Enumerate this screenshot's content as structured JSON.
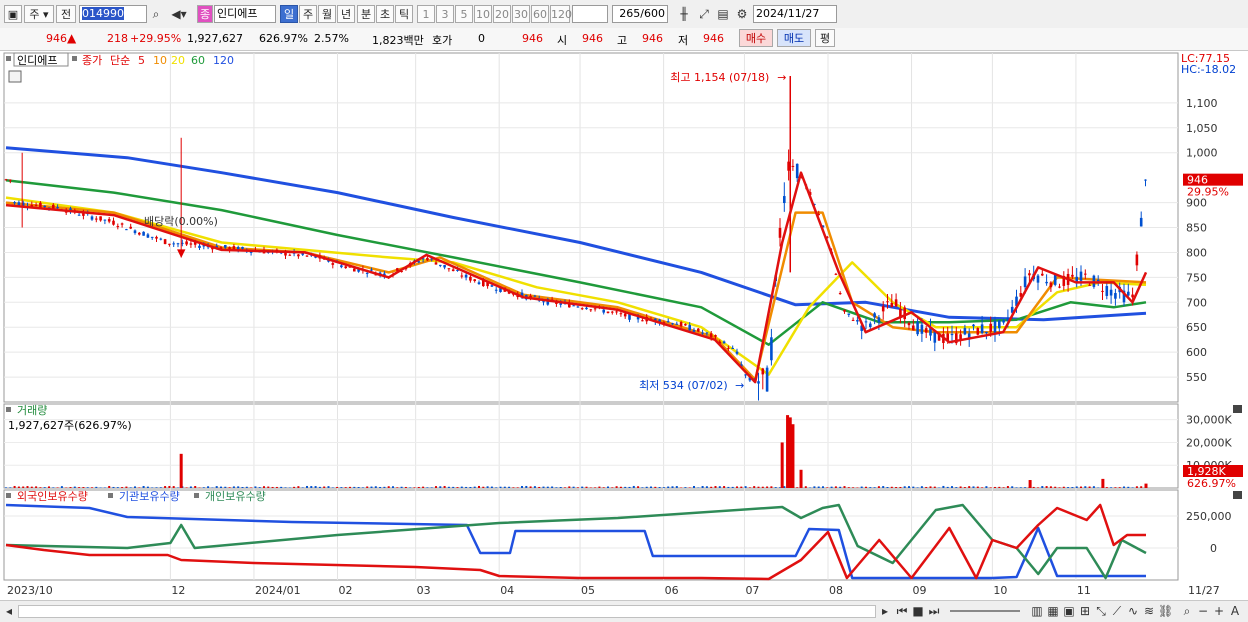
{
  "toolbar": {
    "type_label": "주",
    "market_label": "전",
    "code": "014990",
    "name_badge": "종",
    "name": "인디에프",
    "periods": [
      "일",
      "주",
      "월",
      "년",
      "분",
      "초",
      "틱"
    ],
    "period_selected": "일",
    "intervals": [
      "1",
      "3",
      "5",
      "10",
      "20",
      "30",
      "60",
      "120"
    ],
    "count": "265",
    "count_total": "/600",
    "date": "2024/11/27"
  },
  "quote": {
    "price": "946",
    "price_arrow": "▲",
    "change": "218",
    "change_pct": "+29.95%",
    "volume": "1,927,627",
    "volume_pct": "626.97%",
    "turnover": "2.57%",
    "amount": "1,823백만",
    "hoga_label": "호가",
    "hoga_value": "0",
    "hoga_price": "946",
    "open_label": "시",
    "open": "946",
    "high_label": "고",
    "high": "946",
    "low_label": "저",
    "low": "946",
    "buy_label": "매수",
    "sell_label": "매도",
    "avg_label": "평"
  },
  "colors": {
    "up": "#e00000",
    "down": "#0050d0",
    "ma5": "#e01010",
    "ma10": "#f08c00",
    "ma20": "#f0e000",
    "ma60": "#1f9a3a",
    "ma120": "#2050e0",
    "foreign": "#e01010",
    "institution": "#2050e0",
    "individual": "#2e8b57"
  },
  "chart_data": [
    {
      "type": "candlestick",
      "legend": {
        "name": "인디에프",
        "price_label": "종가",
        "ma_label": "단순",
        "ma_periods": [
          "5",
          "10",
          "20",
          "60",
          "120"
        ]
      },
      "ylim": [
        500,
        1180
      ],
      "yticks": [
        "550",
        "600",
        "650",
        "700",
        "750",
        "800",
        "850",
        "900",
        "1,000",
        "1,050",
        "1,100"
      ],
      "lc_label": "LC:77.15",
      "hc_label": "HC:-18.02",
      "last_price_label": "946",
      "last_change_label": "29.95%",
      "high_marker": "최고 1,154 (07/18)",
      "low_marker": "최저 534 (07/02)",
      "dividend_marker": "배당락(0.00%)",
      "xticks": [
        "2023/10",
        "12",
        "2024/01",
        "02",
        "03",
        "04",
        "05",
        "06",
        "07",
        "08",
        "09",
        "10",
        "11",
        "11/27"
      ],
      "ohlc_path": [
        [
          "2023/10/04",
          900
        ],
        [
          "2023/10/20",
          890
        ],
        [
          "2023/11/10",
          860
        ],
        [
          "2023/11/30",
          820
        ],
        [
          "2023/12/20",
          810
        ],
        [
          "2024/01/10",
          800
        ],
        [
          "2024/01/25",
          790
        ],
        [
          "2024/02/05",
          770
        ],
        [
          "2024/02/20",
          755
        ],
        [
          "2024/03/05",
          790
        ],
        [
          "2024/03/20",
          750
        ],
        [
          "2024/04/05",
          720
        ],
        [
          "2024/04/20",
          700
        ],
        [
          "2024/05/05",
          690
        ],
        [
          "2024/05/20",
          670
        ],
        [
          "2024/06/05",
          660
        ],
        [
          "2024/06/20",
          630
        ],
        [
          "2024/06/28",
          600
        ],
        [
          "2024/07/02",
          545
        ],
        [
          "2024/07/10",
          540
        ],
        [
          "2024/07/15",
          900
        ],
        [
          "2024/07/18",
          1000
        ],
        [
          "2024/07/25",
          920
        ],
        [
          "2024/08/01",
          830
        ],
        [
          "2024/08/07",
          680
        ],
        [
          "2024/08/15",
          650
        ],
        [
          "2024/08/25",
          700
        ],
        [
          "2024/09/05",
          640
        ],
        [
          "2024/09/15",
          625
        ],
        [
          "2024/09/25",
          645
        ],
        [
          "2024/10/05",
          650
        ],
        [
          "2024/10/15",
          760
        ],
        [
          "2024/10/25",
          740
        ],
        [
          "2024/11/05",
          750
        ],
        [
          "2024/11/15",
          720
        ],
        [
          "2024/11/22",
          710
        ],
        [
          "2024/11/27",
          946
        ]
      ]
    },
    {
      "type": "bar",
      "title": "거래량",
      "last_value_label": "1,927,627주(626.97%)",
      "yticks": [
        "10,000K",
        "20,000K",
        "30,000K"
      ],
      "side_label_value": "1,928K",
      "side_label_pct": "626.97%",
      "spikes": [
        [
          "2023/12/05",
          15000
        ],
        [
          "2024/07/15",
          20000
        ],
        [
          "2024/07/17",
          32000
        ],
        [
          "2024/07/18",
          31000
        ],
        [
          "2024/07/19",
          28000
        ],
        [
          "2024/07/22",
          8000
        ],
        [
          "2024/10/15",
          3500
        ],
        [
          "2024/11/11",
          4000
        ],
        [
          "2024/11/27",
          1928
        ]
      ]
    },
    {
      "type": "line",
      "series": [
        {
          "name": "외국인보유수량"
        },
        {
          "name": "기관보유수량"
        },
        {
          "name": "개인보유수량"
        }
      ],
      "yticks": [
        "0",
        "250,000"
      ]
    }
  ]
}
